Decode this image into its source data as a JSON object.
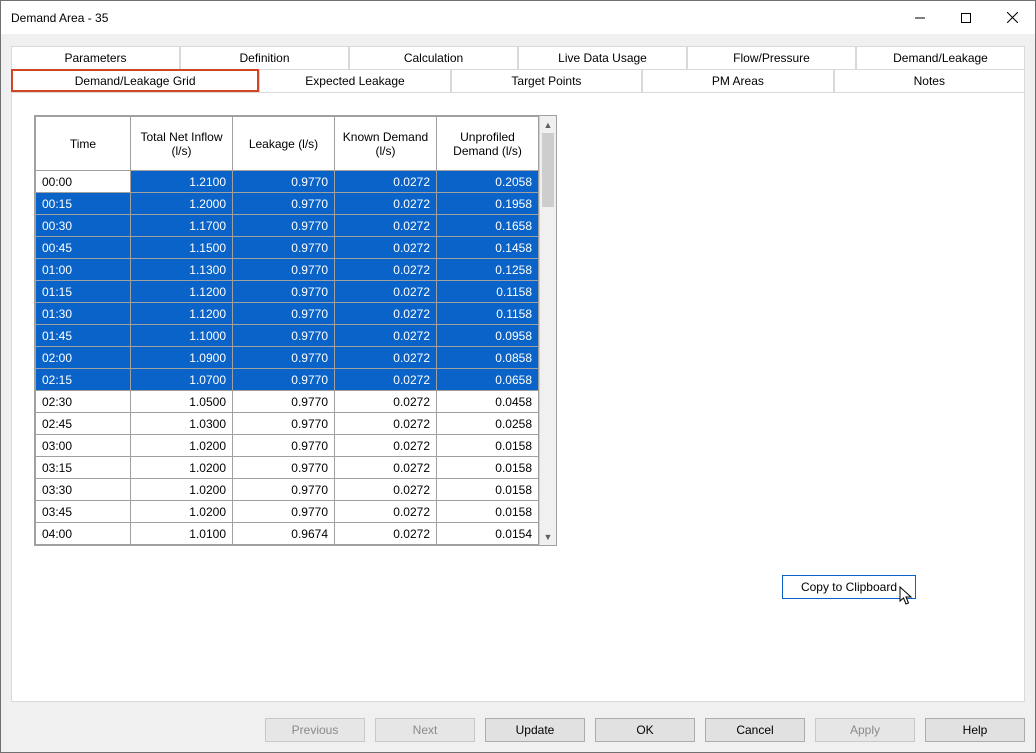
{
  "window": {
    "title": "Demand Area - 35"
  },
  "tabs": {
    "row1": [
      {
        "label": "Parameters"
      },
      {
        "label": "Definition"
      },
      {
        "label": "Calculation"
      },
      {
        "label": "Live Data Usage"
      },
      {
        "label": "Flow/Pressure"
      },
      {
        "label": "Demand/Leakage"
      }
    ],
    "row2": [
      {
        "label": "Demand/Leakage Grid"
      },
      {
        "label": "Expected Leakage"
      },
      {
        "label": "Target Points"
      },
      {
        "label": "PM Areas"
      },
      {
        "label": "Notes"
      }
    ]
  },
  "grid": {
    "headers": {
      "time": "Time",
      "total_net_inflow": "Total Net Inflow (l/s)",
      "leakage": "Leakage (l/s)",
      "known_demand": "Known Demand (l/s)",
      "unprofiled_demand": "Unprofiled Demand (l/s)"
    },
    "rows": [
      {
        "time": "00:00",
        "inflow": "1.2100",
        "leakage": "0.9770",
        "known": "0.0272",
        "unprof": "0.2058",
        "selected": true,
        "timeWhite": true
      },
      {
        "time": "00:15",
        "inflow": "1.2000",
        "leakage": "0.9770",
        "known": "0.0272",
        "unprof": "0.1958",
        "selected": true
      },
      {
        "time": "00:30",
        "inflow": "1.1700",
        "leakage": "0.9770",
        "known": "0.0272",
        "unprof": "0.1658",
        "selected": true
      },
      {
        "time": "00:45",
        "inflow": "1.1500",
        "leakage": "0.9770",
        "known": "0.0272",
        "unprof": "0.1458",
        "selected": true
      },
      {
        "time": "01:00",
        "inflow": "1.1300",
        "leakage": "0.9770",
        "known": "0.0272",
        "unprof": "0.1258",
        "selected": true
      },
      {
        "time": "01:15",
        "inflow": "1.1200",
        "leakage": "0.9770",
        "known": "0.0272",
        "unprof": "0.1158",
        "selected": true
      },
      {
        "time": "01:30",
        "inflow": "1.1200",
        "leakage": "0.9770",
        "known": "0.0272",
        "unprof": "0.1158",
        "selected": true
      },
      {
        "time": "01:45",
        "inflow": "1.1000",
        "leakage": "0.9770",
        "known": "0.0272",
        "unprof": "0.0958",
        "selected": true
      },
      {
        "time": "02:00",
        "inflow": "1.0900",
        "leakage": "0.9770",
        "known": "0.0272",
        "unprof": "0.0858",
        "selected": true
      },
      {
        "time": "02:15",
        "inflow": "1.0700",
        "leakage": "0.9770",
        "known": "0.0272",
        "unprof": "0.0658",
        "selected": true
      },
      {
        "time": "02:30",
        "inflow": "1.0500",
        "leakage": "0.9770",
        "known": "0.0272",
        "unprof": "0.0458",
        "selected": false
      },
      {
        "time": "02:45",
        "inflow": "1.0300",
        "leakage": "0.9770",
        "known": "0.0272",
        "unprof": "0.0258",
        "selected": false
      },
      {
        "time": "03:00",
        "inflow": "1.0200",
        "leakage": "0.9770",
        "known": "0.0272",
        "unprof": "0.0158",
        "selected": false
      },
      {
        "time": "03:15",
        "inflow": "1.0200",
        "leakage": "0.9770",
        "known": "0.0272",
        "unprof": "0.0158",
        "selected": false
      },
      {
        "time": "03:30",
        "inflow": "1.0200",
        "leakage": "0.9770",
        "known": "0.0272",
        "unprof": "0.0158",
        "selected": false
      },
      {
        "time": "03:45",
        "inflow": "1.0200",
        "leakage": "0.9770",
        "known": "0.0272",
        "unprof": "0.0158",
        "selected": false
      },
      {
        "time": "04:00",
        "inflow": "1.0100",
        "leakage": "0.9674",
        "known": "0.0272",
        "unprof": "0.0154",
        "selected": false
      }
    ]
  },
  "buttons": {
    "copy": "Copy to Clipboard",
    "previous": "Previous",
    "next": "Next",
    "update": "Update",
    "ok": "OK",
    "cancel": "Cancel",
    "apply": "Apply",
    "help": "Help"
  }
}
